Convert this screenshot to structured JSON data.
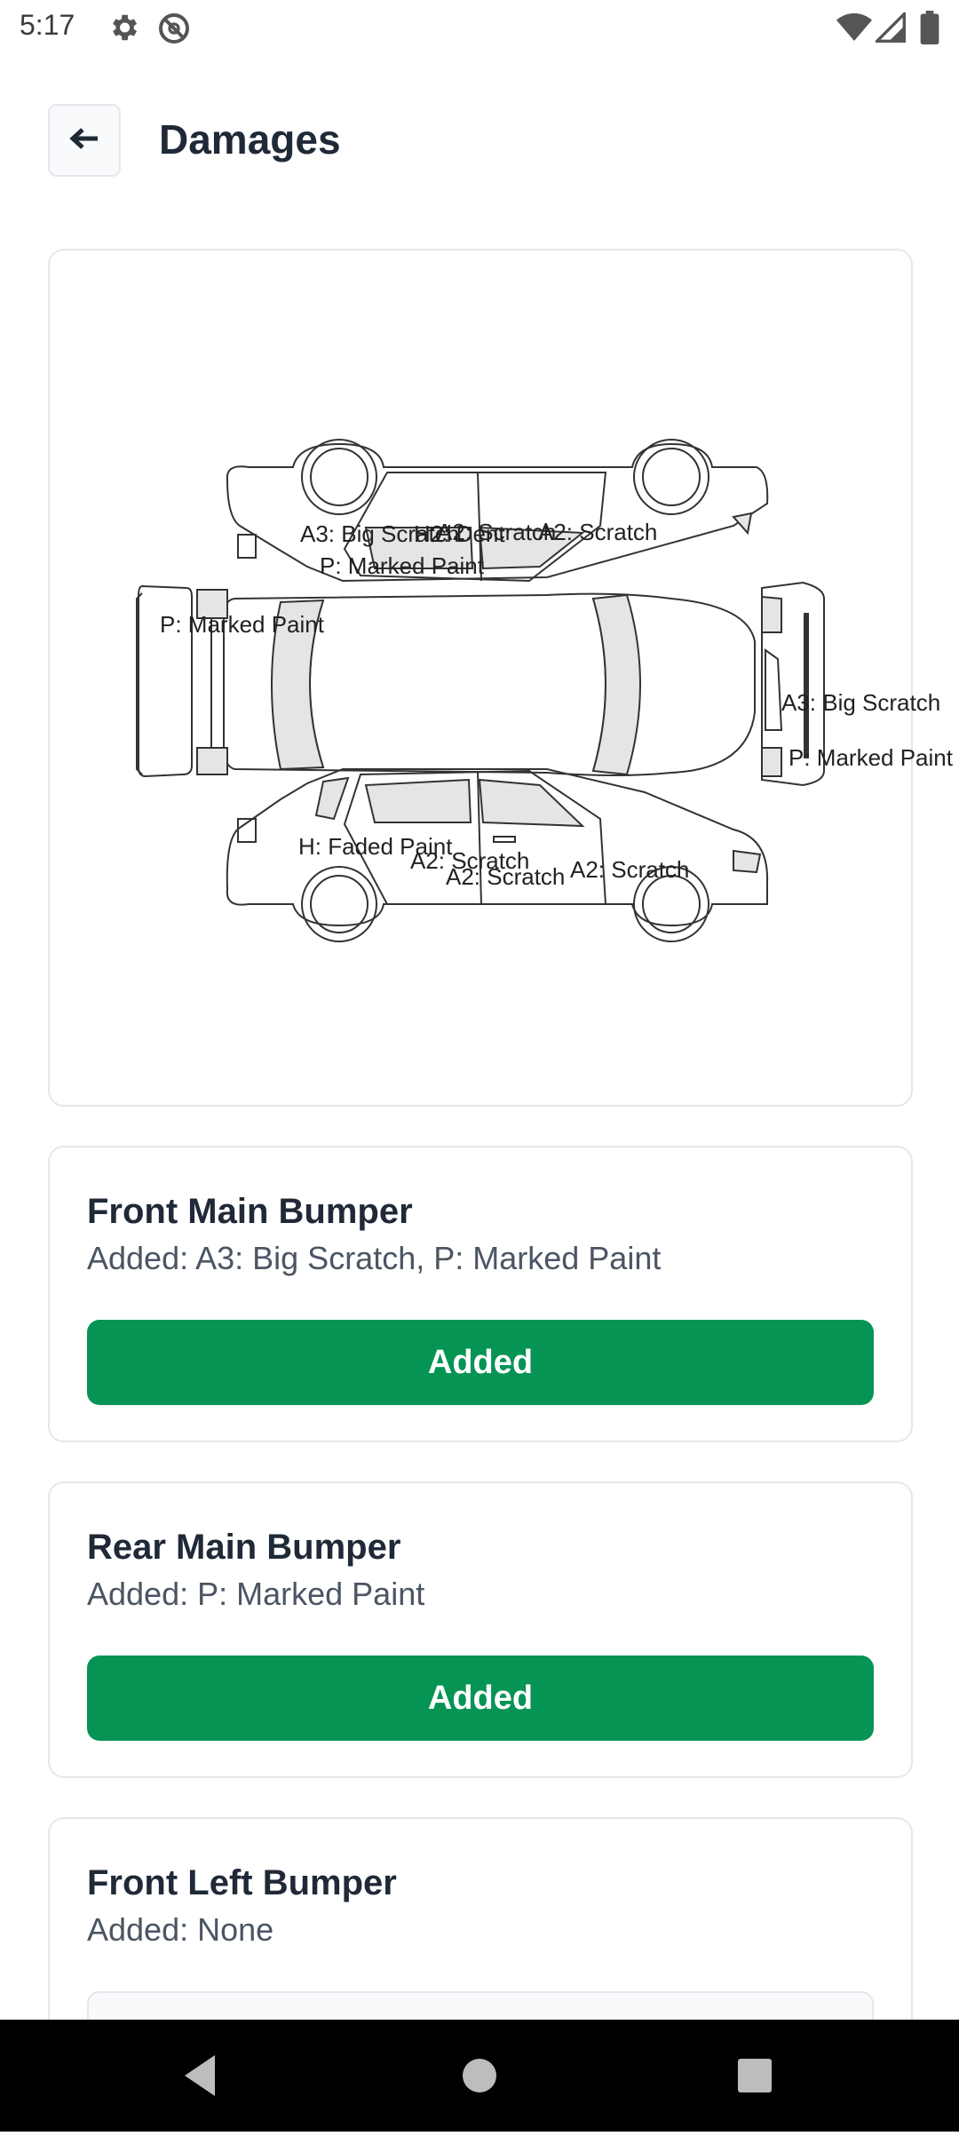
{
  "status_bar": {
    "time": "5:17",
    "left_icons": [
      "gear-icon",
      "no-disturb-icon"
    ],
    "right_icons": [
      "wifi-icon",
      "signal-icon",
      "battery-icon"
    ]
  },
  "header": {
    "back_icon": "arrow-left-icon",
    "title": "Damages"
  },
  "diagram": {
    "labels": [
      "A3: Big Scratch",
      "H2: Dent",
      "A2: Scratch",
      "A2: Scratch",
      "P: Marked Paint",
      "P: Marked Paint",
      "A3: Big Scratch",
      "P: Marked Paint",
      "H: Faded Paint",
      "A2: Scratch",
      "A2: Scratch",
      "A2: Scratch"
    ]
  },
  "panels": [
    {
      "name": "Front Main Bumper",
      "added": "Added: A3: Big Scratch, P: Marked Paint",
      "button": "Added"
    },
    {
      "name": "Rear Main Bumper",
      "added": "Added: P: Marked Paint",
      "button": "Added"
    },
    {
      "name": "Front Left Bumper",
      "added": "Added: None"
    }
  ],
  "colors": {
    "accent_green": "#069455",
    "card_border": "#e5e7eb",
    "title_text": "#1f2937",
    "secondary_text": "#4b5563"
  },
  "nav": {
    "icons": [
      "back-triangle-icon",
      "home-circle-icon",
      "recents-square-icon"
    ]
  }
}
